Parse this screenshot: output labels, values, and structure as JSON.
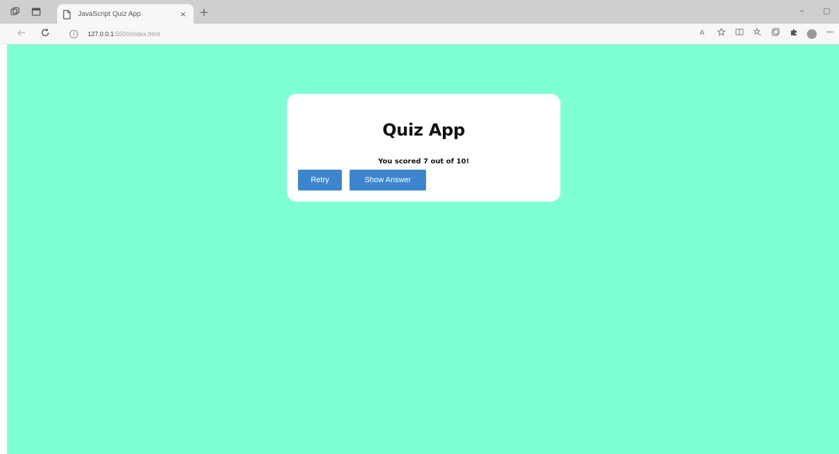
{
  "browser": {
    "tab_title": "JavaScript Quiz App",
    "tab_close": "×",
    "new_tab": "+",
    "url_host": "127.0.0.1",
    "url_path": ":5500/index.html",
    "window_minimize": "–",
    "window_restore": "▢"
  },
  "quiz": {
    "title": "Quiz App",
    "score_text": "You scored 7 out of 10!",
    "retry_label": "Retry",
    "show_answer_label": "Show Answer"
  },
  "colors": {
    "page_background": "#7fffd4",
    "card_background": "#ffffff",
    "button_background": "#3d86cd"
  }
}
